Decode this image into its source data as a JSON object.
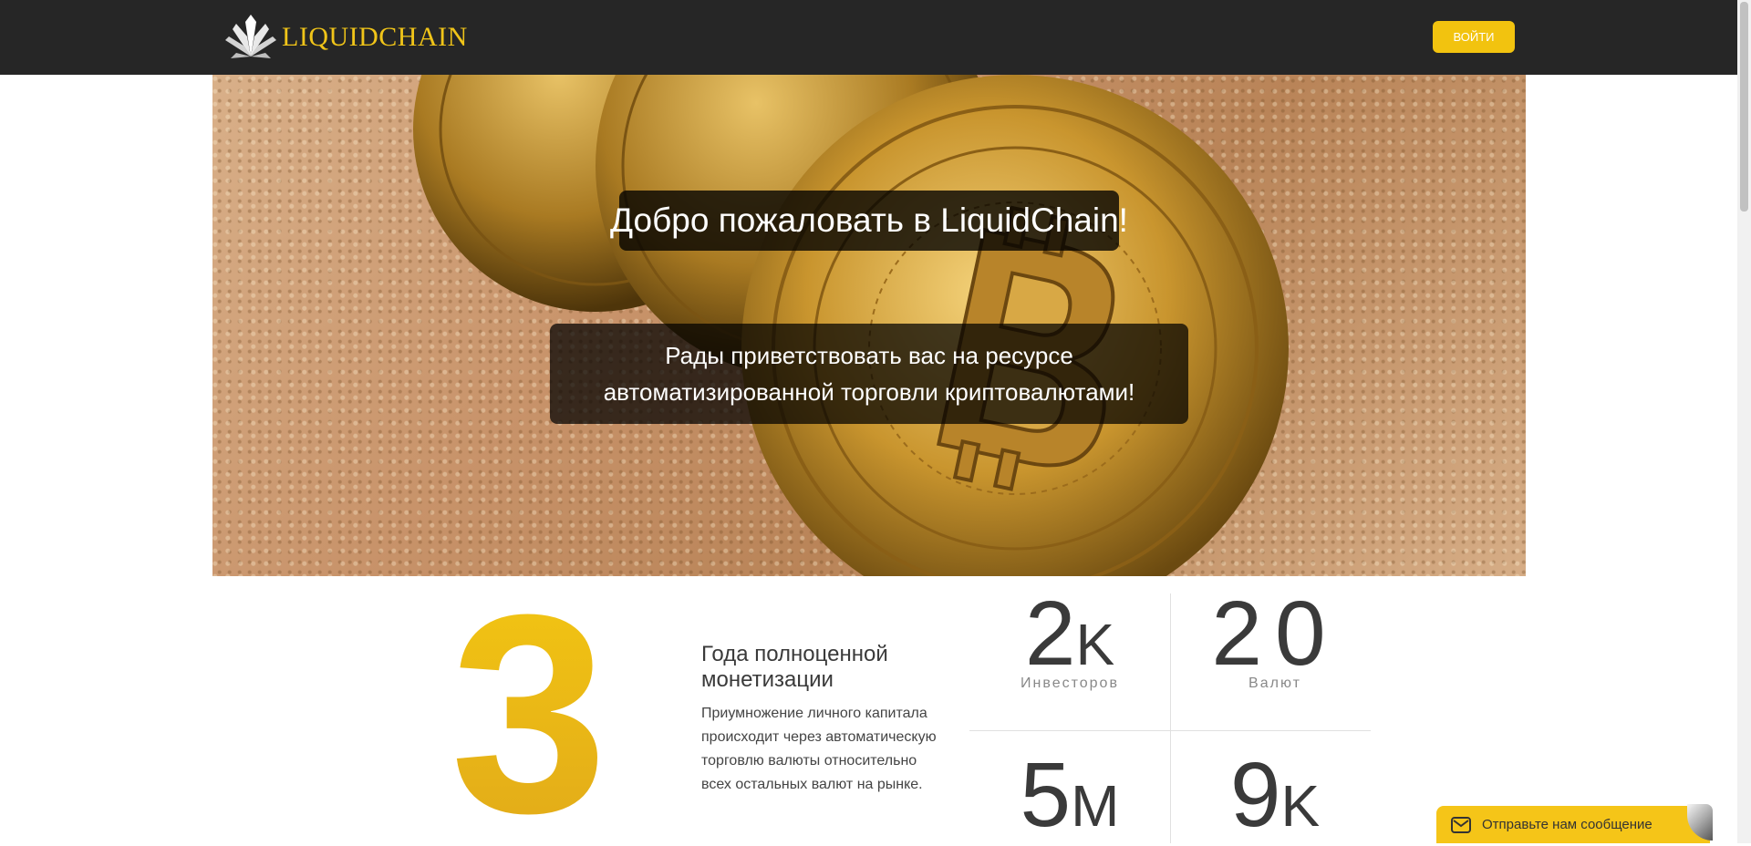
{
  "header": {
    "brand": "LIQUIDCHAIN",
    "login_label": "ВОЙТИ"
  },
  "hero": {
    "title": "Добро пожаловать в LiquidChain!",
    "subtitle": "Рады приветствовать вас на ресурсе автоматизированной торговли криптовалютами!"
  },
  "years": {
    "value": "3",
    "title": "Года полноценной монетизации",
    "description": "Приумножение личного капитала происходит через автоматическую торговлю валюты относительно всех остальных валют на рынке."
  },
  "stats": [
    {
      "value": "2",
      "suffix": "K",
      "label": "Инвесторов"
    },
    {
      "value": "20",
      "suffix": "",
      "label": "Валют"
    },
    {
      "value": "5",
      "suffix": "M",
      "label": ""
    },
    {
      "value": "9",
      "suffix": "K",
      "label": ""
    }
  ],
  "chat": {
    "label": "Отправьте нам сообщение"
  },
  "colors": {
    "accent": "#f2c30f",
    "header_bg": "#262626"
  }
}
